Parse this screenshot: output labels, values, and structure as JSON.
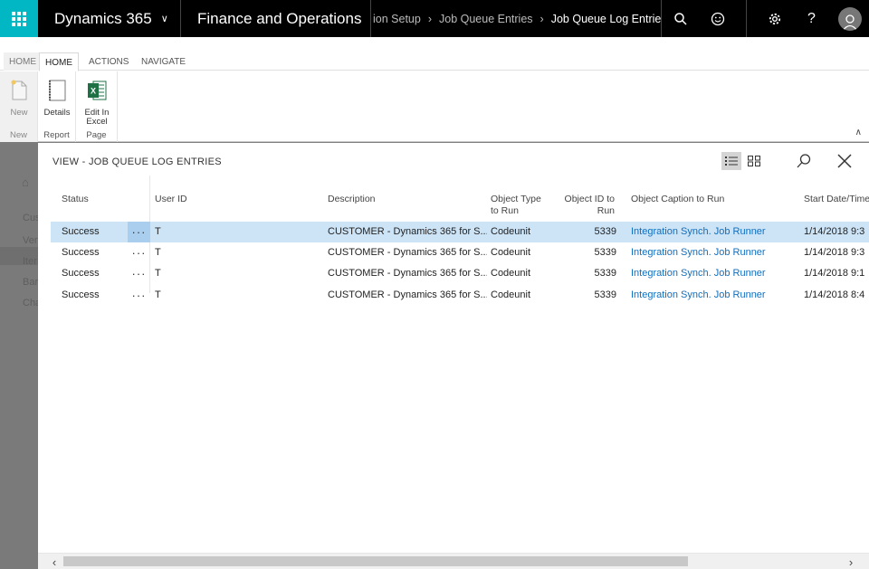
{
  "topbar": {
    "brand": "Dynamics 365",
    "app_name": "Finance and Operations",
    "breadcrumbs": [
      "ion Setup",
      "Job Queue Entries",
      "Job Queue Log Entries"
    ]
  },
  "background": {
    "items": [
      "Cus",
      "Ven",
      "Iter",
      "Bar",
      "Cha"
    ]
  },
  "ribbon": {
    "tabs": [
      "HOME",
      "HOME",
      "ACTIONS",
      "NAVIGATE"
    ],
    "groups": {
      "new": {
        "label": "New",
        "buttons": [
          "New"
        ]
      },
      "report": {
        "label": "Report",
        "buttons": [
          "Details"
        ]
      },
      "page": {
        "label": "Page",
        "buttons": [
          "Edit In Excel"
        ]
      }
    }
  },
  "panel": {
    "title": "VIEW - JOB QUEUE LOG ENTRIES",
    "columns": {
      "status": "Status",
      "user_id": "User ID",
      "description": "Description",
      "object_type": "Object Type to Run",
      "object_id": "Object ID to Run",
      "object_caption": "Object Caption to Run",
      "start": "Start Date/Time"
    },
    "more_label": "···",
    "rows": [
      {
        "status": "Success",
        "user_id": "T",
        "description": "CUSTOMER - Dynamics 365 for S...",
        "object_type": "Codeunit",
        "object_id": "5339",
        "object_caption": "Integration Synch. Job Runner",
        "start": "1/14/2018 9:3"
      },
      {
        "status": "Success",
        "user_id": "T",
        "description": "CUSTOMER - Dynamics 365 for S...",
        "object_type": "Codeunit",
        "object_id": "5339",
        "object_caption": "Integration Synch. Job Runner",
        "start": "1/14/2018 9:3"
      },
      {
        "status": "Success",
        "user_id": "T",
        "description": "CUSTOMER - Dynamics 365 for S...",
        "object_type": "Codeunit",
        "object_id": "5339",
        "object_caption": "Integration Synch. Job Runner",
        "start": "1/14/2018 9:1"
      },
      {
        "status": "Success",
        "user_id": "T",
        "description": "CUSTOMER - Dynamics 365 for S...",
        "object_type": "Codeunit",
        "object_id": "5339",
        "object_caption": "Integration Synch. Job Runner",
        "start": "1/14/2018 8:4"
      }
    ]
  },
  "colors": {
    "accent": "#00b7c3",
    "link": "#106ebe",
    "selected_row": "#cde4f7"
  }
}
